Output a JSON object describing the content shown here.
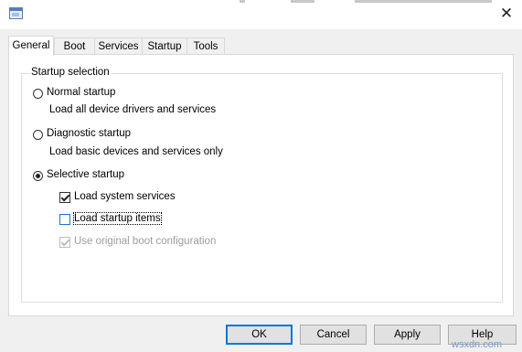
{
  "window": {
    "close_glyph": "✕"
  },
  "tabs": [
    {
      "label": "General",
      "active": true
    },
    {
      "label": "Boot"
    },
    {
      "label": "Services"
    },
    {
      "label": "Startup"
    },
    {
      "label": "Tools"
    }
  ],
  "group": {
    "title": "Startup selection"
  },
  "options": {
    "normal": {
      "label": "Normal startup",
      "desc": "Load all device drivers and services",
      "selected": false
    },
    "diagnostic": {
      "label": "Diagnostic startup",
      "desc": "Load basic devices and services only",
      "selected": false
    },
    "selective": {
      "label": "Selective startup",
      "selected": true
    }
  },
  "checkboxes": {
    "system_services": {
      "label": "Load system services",
      "checked": true
    },
    "startup_items": {
      "label": "Load startup items",
      "checked": false
    },
    "boot_config": {
      "label": "Use original boot configuration",
      "checked": true,
      "disabled": true
    }
  },
  "buttons": {
    "ok": "OK",
    "cancel": "Cancel",
    "apply": "Apply",
    "help": "Help"
  },
  "watermark": "wsxdn.com",
  "colors": {
    "accent": "#0078d7",
    "panel_bg": "#ffffff",
    "window_bg": "#f0f0f0"
  }
}
